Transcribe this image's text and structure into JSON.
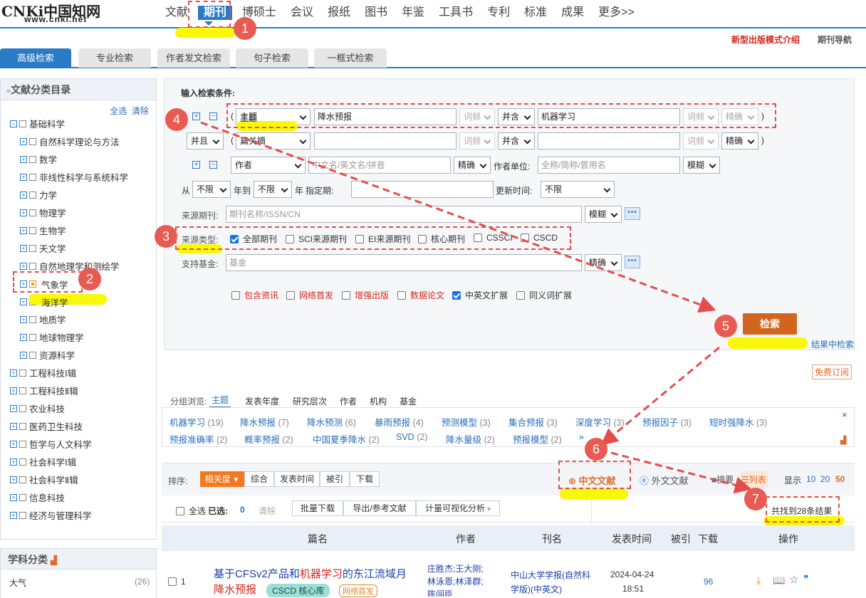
{
  "logo": {
    "cn": "CNKi中国知网",
    "url": "www.cnki.net"
  },
  "nav": [
    "文献",
    "期刊",
    "博硕士",
    "会议",
    "报纸",
    "图书",
    "年鉴",
    "工具书",
    "专利",
    "标准",
    "成果",
    "更多>>"
  ],
  "top_links": {
    "new_mode": "新型出版模式介绍",
    "journal_nav": "期刊导航"
  },
  "tabs": [
    "高级检索",
    "专业检索",
    "作者发文检索",
    "句子检索",
    "一框式检索"
  ],
  "sidebar": {
    "title": "文献分类目录",
    "select_all": "全选",
    "clear": "清除",
    "items": [
      "基础科学",
      "自然科学理论与方法",
      "数学",
      "非线性科学与系统科学",
      "力学",
      "物理学",
      "生物学",
      "天文学",
      "自然地理学和测绘学",
      "气象学",
      "海洋学",
      "地质学",
      "地球物理学",
      "资源科学",
      "工程科技Ⅰ辑",
      "工程科技Ⅱ辑",
      "农业科技",
      "医药卫生科技",
      "哲学与人文科学",
      "社会科学Ⅰ辑",
      "社会科学Ⅱ辑",
      "信息科技",
      "经济与管理科学"
    ],
    "subject_title": "学科分类",
    "subject_item": "大气",
    "subject_count": "(26)"
  },
  "form": {
    "title": "输入检索条件:",
    "row1": {
      "field": "主题",
      "term1": "降水预报",
      "freq1": "词频",
      "op": "并含",
      "term2": "机器学习",
      "freq2": "词频",
      "match": "精确"
    },
    "row2": {
      "logic": "并且",
      "field": "篇关摘",
      "freq1": "词频",
      "op": "并含",
      "freq2": "词频",
      "match": "精确"
    },
    "row3": {
      "field": "作者",
      "placeholder": "中文名/英文名/拼音",
      "match": "精确",
      "unit_label": "作者单位:",
      "unit_placeholder": "全称/简称/曾用名",
      "unit_match": "模糊"
    },
    "date": {
      "from": "从",
      "from_val": "不限",
      "year_to": "年到",
      "to_val": "不限",
      "year": "年",
      "specify": "指定期:",
      "update_label": "更新时间:",
      "update_val": "不限"
    },
    "source_label": "来源期刊:",
    "source_placeholder": "期刊名称/ISSN/CN",
    "source_match": "模糊",
    "source_type_label": "来源类型:",
    "source_types": [
      "全部期刊",
      "SCI来源期刊",
      "EI来源期刊",
      "核心期刊",
      "CSSCI",
      "CSCD"
    ],
    "fund_label": "支持基金:",
    "fund_placeholder": "基金",
    "fund_match": "精确",
    "options": [
      "包含资讯",
      "网络首发",
      "增强出版",
      "数据论文",
      "中英文扩展",
      "同义词扩展"
    ],
    "search_btn": "检索",
    "in_result": "结果中检索",
    "free_sub": "免费订阅"
  },
  "group": {
    "label": "分组浏览:",
    "tabs": [
      "主题",
      "发表年度",
      "研究层次",
      "作者",
      "机构",
      "基金"
    ]
  },
  "topics": [
    {
      "name": "机器学习",
      "count": "(19)"
    },
    {
      "name": "降水预报",
      "count": "(7)"
    },
    {
      "name": "降水预测",
      "count": "(6)"
    },
    {
      "name": "暴雨预报",
      "count": "(4)"
    },
    {
      "name": "预测模型",
      "count": "(3)"
    },
    {
      "name": "集合预报",
      "count": "(3)"
    },
    {
      "name": "深度学习",
      "count": "(3)"
    },
    {
      "name": "预报因子",
      "count": "(3)"
    },
    {
      "name": "短时强降水",
      "count": "(3)"
    },
    {
      "name": "预报准确率",
      "count": "(2)"
    },
    {
      "name": "概率预报",
      "count": "(2)"
    },
    {
      "name": "中国夏季降水",
      "count": "(2)"
    },
    {
      "name": "SVD",
      "count": "(2)"
    },
    {
      "name": "降水量级",
      "count": "(2)"
    },
    {
      "name": "预报模型",
      "count": "(2)"
    },
    {
      "name": "»",
      "count": ""
    }
  ],
  "sort": {
    "label": "排序:",
    "options": [
      "相关度",
      "综合",
      "发表时间",
      "被引",
      "下载"
    ],
    "zh": "中文文献",
    "en": "外文文献",
    "abstract": "摘要",
    "list": "列表",
    "display": "显示",
    "sizes": [
      "10",
      "20",
      "50"
    ]
  },
  "selection": {
    "select_all": "全选",
    "selected": "已选:",
    "count": "0",
    "clear": "清除",
    "batch": "批量下载",
    "export": "导出/参考文献",
    "viz": "计量可视化分析",
    "result": "共找到28条结果"
  },
  "table": {
    "headers": [
      "篇名",
      "作者",
      "刊名",
      "发表时间",
      "被引",
      "下载",
      "操作"
    ]
  },
  "row": {
    "num": "1",
    "title_a": "基于CFSv2产品和",
    "title_kw": "机器学习",
    "title_b": "的东江流域月",
    "title_c": "降水预报",
    "tag1": "CSCD",
    "tag2": "核心库",
    "tag3": "网络首发",
    "authors": "庄胜杰;王大刚;林泳恩;林泽群;陈闯臣",
    "journal": "中山大学学报(自然科学版)(中英文)",
    "date": "2024-04-24",
    "time": "18:51",
    "downloads": "96"
  },
  "steps": [
    "1",
    "2",
    "3",
    "4",
    "5",
    "6",
    "7"
  ]
}
